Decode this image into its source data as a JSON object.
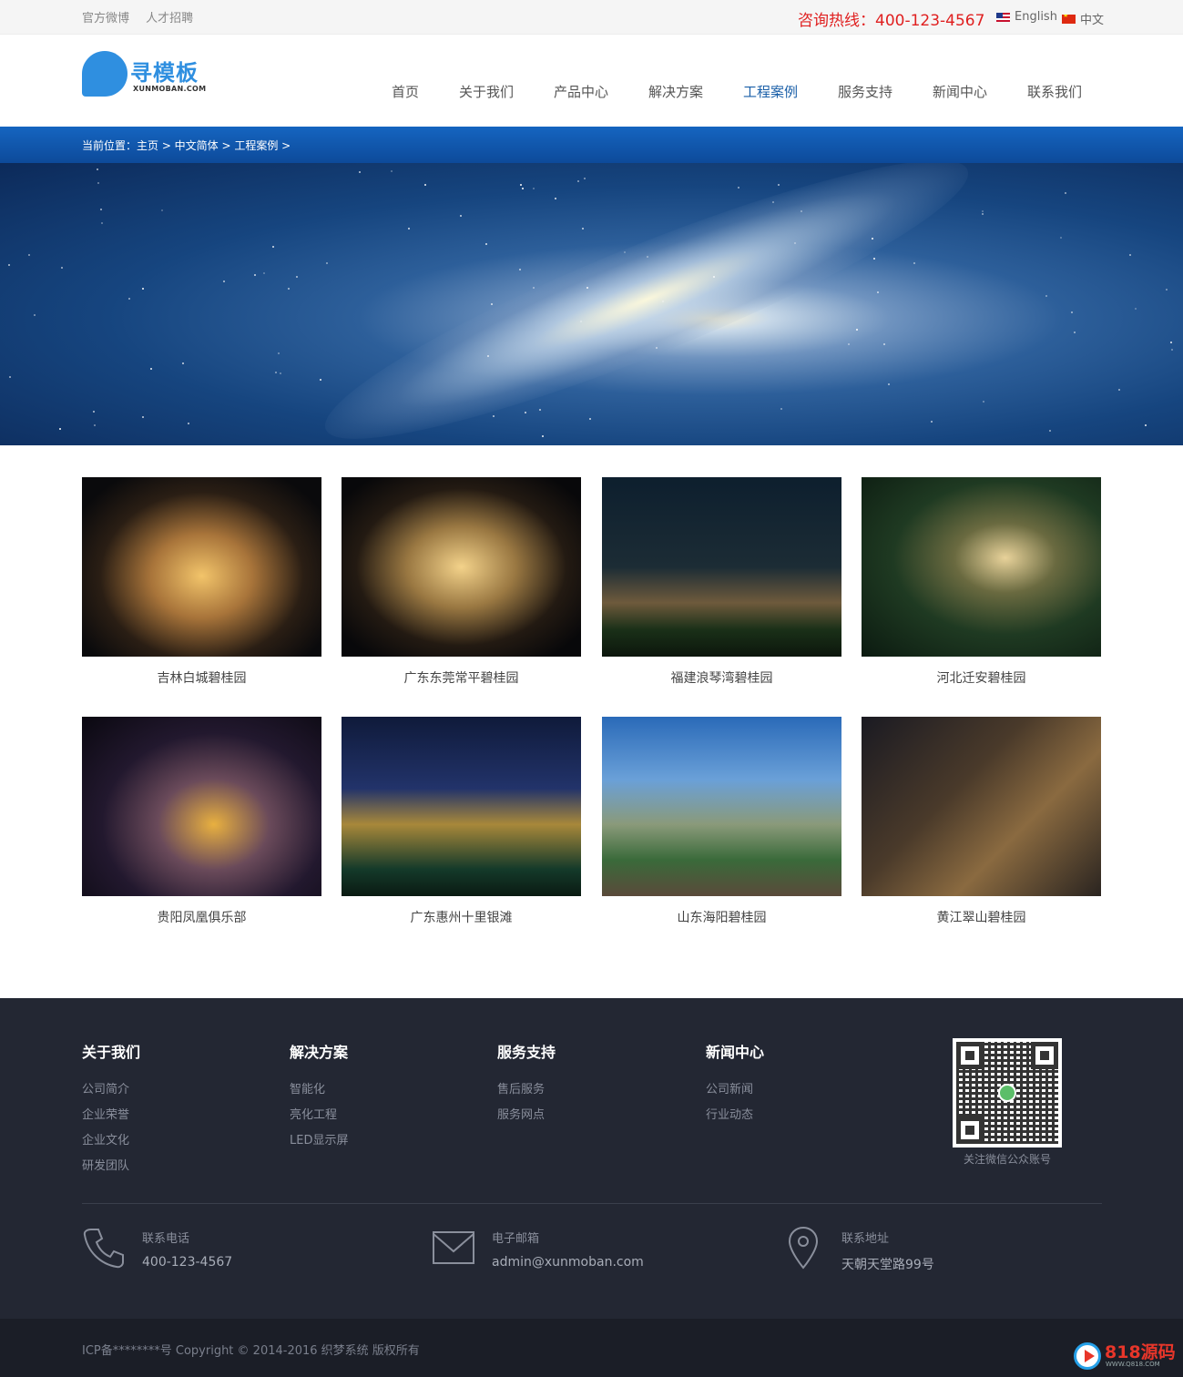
{
  "topbar": {
    "links": [
      "官方微博",
      "人才招聘"
    ],
    "hotline": "咨询热线：400-123-4567",
    "lang_en": "English",
    "lang_cn": "中文"
  },
  "logo": {
    "name": "寻模板",
    "sub": "XUNMOBAN.COM",
    "color": "#2f8fe0"
  },
  "nav": [
    "首页",
    "关于我们",
    "产品中心",
    "解决方案",
    "工程案例",
    "服务支持",
    "新闻中心",
    "联系我们"
  ],
  "nav_active": "工程案例",
  "breadcrumb": "当前位置：主页 > 中文简体 > 工程案例 >",
  "cases": [
    "吉林白城碧桂园",
    "广东东莞常平碧桂园",
    "福建浪琴湾碧桂园",
    "河北迁安碧桂园",
    "贵阳凤凰俱乐部",
    "广东惠州十里银滩",
    "山东海阳碧桂园",
    "黄江翠山碧桂园"
  ],
  "footer": {
    "columns": [
      {
        "title": "关于我们",
        "items": [
          "公司简介",
          "企业荣誉",
          "企业文化",
          "研发团队"
        ]
      },
      {
        "title": "解决方案",
        "items": [
          "智能化",
          "亮化工程",
          "LED显示屏"
        ]
      },
      {
        "title": "服务支持",
        "items": [
          "售后服务",
          "服务网点"
        ]
      },
      {
        "title": "新闻中心",
        "items": [
          "公司新闻",
          "行业动态"
        ]
      }
    ],
    "qr_caption": "关注微信公众账号",
    "contacts": [
      {
        "label": "联系电话",
        "value": "400-123-4567",
        "icon": "phone-icon"
      },
      {
        "label": "电子邮箱",
        "value": "admin@xunmoban.com",
        "icon": "mail-icon"
      },
      {
        "label": "联系地址",
        "value": "天朝天堂路99号",
        "icon": "location-pin-icon"
      }
    ],
    "copyright": "ICP备********号    Copyright © 2014-2016 织梦系统 版权所有",
    "badge_title": "818源码",
    "badge_sub": "WWW.Q818.COM"
  },
  "colors": {
    "accent": "#1565c0",
    "hotline": "#e02020",
    "footer_bg": "#232733"
  }
}
